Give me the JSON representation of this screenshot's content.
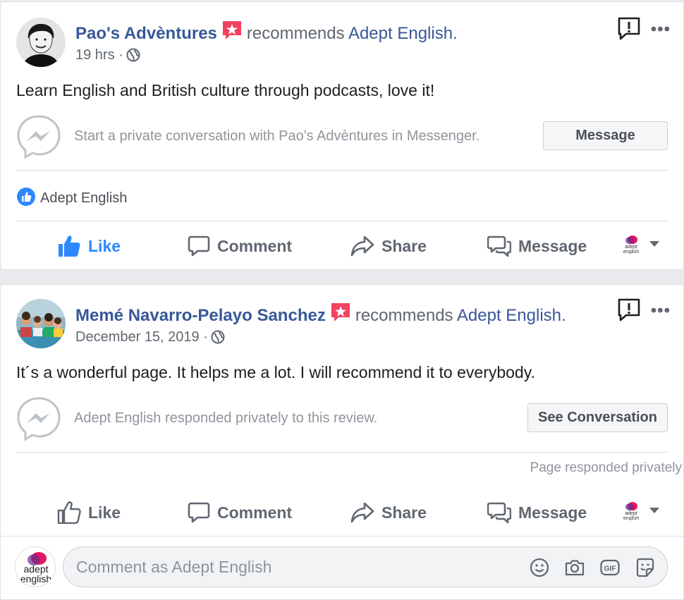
{
  "reviews": [
    {
      "author": "Pao's Advèntures",
      "recommends_text": "recommends",
      "page_name": "Adept English.",
      "time": "19 hrs",
      "meta_sep": "·",
      "text": "Learn English and British culture through podcasts, love it!",
      "messenger_text": "Start a private conversation with Pao's Advèntures in Messenger.",
      "messenger_button": "Message",
      "reaction_name": "Adept English",
      "liked": true
    },
    {
      "author": "Memé Navarro-Pelayo Sanchez",
      "recommends_text": "recommends",
      "page_name": "Adept English.",
      "time": "December 15, 2019",
      "meta_sep": "·",
      "text": "It´s a wonderful page. It helps me a lot. I will recommend it to everybody.",
      "messenger_text": "Adept English responded privately to this review.",
      "messenger_button": "See Conversation",
      "responded_note": "Page responded privately",
      "liked": false
    }
  ],
  "actions": {
    "like": "Like",
    "comment": "Comment",
    "share": "Share",
    "message": "Message"
  },
  "more_label": "•••",
  "composer": {
    "placeholder": "Comment as Adept English"
  },
  "acting_as": {
    "logo_line1": "adept",
    "logo_line2": "english"
  },
  "colors": {
    "link_blue": "#385898",
    "like_blue": "#2d88ff",
    "muted": "#606770",
    "recommend_badge": "#f3425f"
  },
  "icons": [
    "report-icon",
    "more-icon",
    "globe-icon",
    "messenger-icon",
    "like-icon",
    "comment-icon",
    "share-icon",
    "message-icon",
    "emoji-icon",
    "camera-icon",
    "gif-icon",
    "sticker-icon"
  ]
}
